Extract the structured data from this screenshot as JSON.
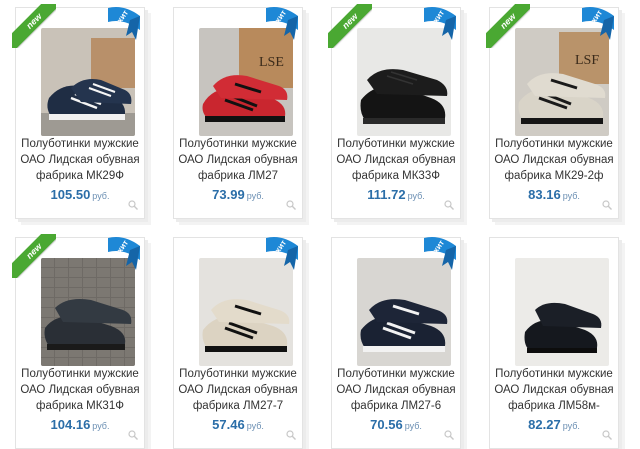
{
  "currency": "руб.",
  "badges": {
    "new": "new",
    "hit": "хит"
  },
  "colors": {
    "price": "#2b6ea8",
    "new_badge": "#4aa832",
    "hit_badge": "#1e88d6"
  },
  "products": [
    {
      "title": [
        "Полуботинки мужские",
        "ОАО Лидская обувная",
        "фабрика МК29Ф"
      ],
      "price": "105.50",
      "new": true,
      "hit": true,
      "image": "navy-sneakers-white-stripes"
    },
    {
      "title": [
        "Полуботинки мужские",
        "ОАО Лидская обувная",
        "фабрика ЛМ27"
      ],
      "price": "73.99",
      "new": false,
      "hit": true,
      "image": "red-sneakers-black-stripes"
    },
    {
      "title": [
        "Полуботинки мужские",
        "ОАО Лидская обувная",
        "фабрика МК33Ф"
      ],
      "price": "111.72",
      "new": true,
      "hit": true,
      "image": "black-suede-sneakers"
    },
    {
      "title": [
        "Полуботинки мужские",
        "ОАО Лидская обувная",
        "фабрика МК29-2ф"
      ],
      "price": "83.16",
      "new": true,
      "hit": true,
      "image": "beige-black-sneakers"
    },
    {
      "title": [
        "Полуботинки мужские",
        "ОАО Лидская обувная",
        "фабрика МК31Ф"
      ],
      "price": "104.16",
      "new": true,
      "hit": true,
      "image": "black-leather-sneakers"
    },
    {
      "title": [
        "Полуботинки мужские",
        "ОАО Лидская обувная",
        "фабрика ЛМ27-7"
      ],
      "price": "57.46",
      "new": false,
      "hit": true,
      "image": "beige-sneakers-black-stripes"
    },
    {
      "title": [
        "Полуботинки мужские",
        "ОАО Лидская обувная",
        "фабрика ЛМ27-6"
      ],
      "price": "70.56",
      "new": false,
      "hit": true,
      "image": "black-sneakers-white-stripes"
    },
    {
      "title": [
        "Полуботинки мужские",
        "ОАО Лидская обувная",
        "фабрика ЛМ58м-"
      ],
      "price": "82.27",
      "new": false,
      "hit": false,
      "image": "black-slipon-shoes"
    }
  ]
}
